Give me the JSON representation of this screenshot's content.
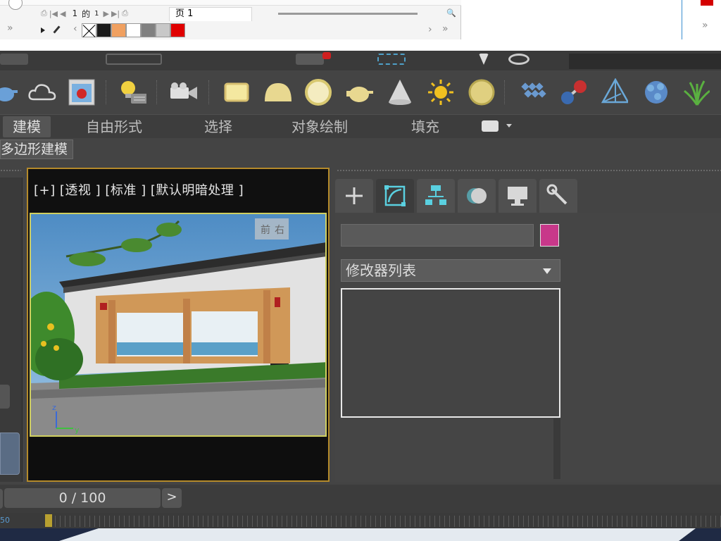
{
  "doc_toolbar": {
    "page_number": "1",
    "of_label": "的",
    "total_pages": "1",
    "page_tab_label": "页 1",
    "swatch_colors": [
      "#1a1a1a",
      "#f0a060",
      "#ffffff",
      "#808080",
      "#c8c8c8",
      "#e00000"
    ]
  },
  "toolbar_icons": [
    "teapot-icon",
    "cloud-icon",
    "render-frame-icon",
    "light-bulb-icon",
    "camera-icon",
    "box-glow-icon",
    "dome-light-icon",
    "sphere-glow-icon",
    "teapot2-icon",
    "cone-icon",
    "sun-icon",
    "orb-icon",
    "grid-icon",
    "molecule-icon",
    "pyramid-icon",
    "crystal-icon",
    "grass-icon"
  ],
  "ribbon": {
    "tabs": [
      {
        "label": "建模",
        "active": true
      },
      {
        "label": "自由形式",
        "active": false
      },
      {
        "label": "选择",
        "active": false
      },
      {
        "label": "对象绘制",
        "active": false
      },
      {
        "label": "填充",
        "active": false
      }
    ],
    "subtab": "多边形建模"
  },
  "viewport": {
    "label": "[+] [透视 ] [标准 ] [默认明暗处理 ]",
    "viewcube_front": "前",
    "viewcube_right": "右",
    "axis_z": "z",
    "axis_y": "y"
  },
  "command_panel": {
    "tab_icons": [
      "plus-icon",
      "modify-icon",
      "hierarchy-icon",
      "motion-icon",
      "display-icon",
      "utilities-wrench-icon"
    ],
    "name_value": "",
    "object_color": "#c8388a",
    "modifier_list_label": "修改器列表"
  },
  "time_slider": {
    "frame_display": "0 / 100",
    "next_label": ">",
    "track_start": "50"
  },
  "colors": {
    "bg": "#444444",
    "viewport_border": "#b48a2a",
    "accent_blue": "#3a8fd0"
  }
}
